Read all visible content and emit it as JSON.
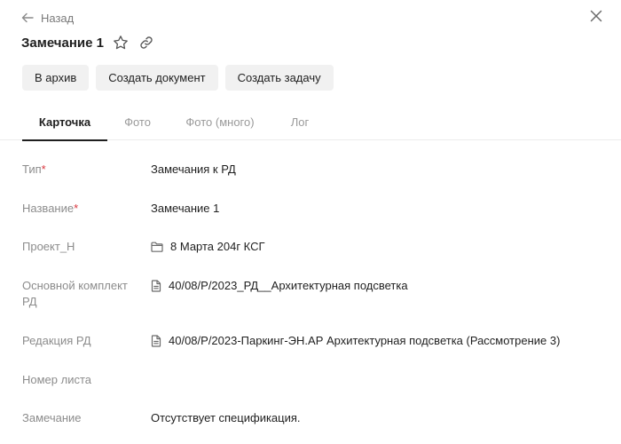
{
  "header": {
    "back_label": "Назад",
    "title": "Замечание 1"
  },
  "actions": [
    {
      "label": "В архив"
    },
    {
      "label": "Создать документ"
    },
    {
      "label": "Создать задачу"
    }
  ],
  "tabs": [
    {
      "label": "Карточка",
      "active": true
    },
    {
      "label": "Фото",
      "active": false
    },
    {
      "label": "Фото (много)",
      "active": false
    },
    {
      "label": "Лог",
      "active": false
    }
  ],
  "fields": [
    {
      "label": "Тип",
      "required": true,
      "required_mark": "*",
      "value": "Замечания к РД",
      "icon": ""
    },
    {
      "label": "Название",
      "required": true,
      "required_mark": "*",
      "value": "Замечание 1",
      "icon": ""
    },
    {
      "label": "Проект_Н",
      "required": false,
      "value": "8 Марта 204г КСГ",
      "icon": "folder-icon"
    },
    {
      "label": "Основной комплект РД",
      "required": false,
      "value": "40/08/Р/2023_РД__Архитектурная подсветка",
      "icon": "document-icon"
    },
    {
      "label": "Редакция РД",
      "required": false,
      "value": "40/08/Р/2023-Паркинг-ЭН.АР Архитектурная подсветка (Рассмотрение 3)",
      "icon": "document-icon"
    },
    {
      "label": "Номер листа",
      "required": false,
      "value": "",
      "icon": ""
    },
    {
      "label": "Замечание",
      "required": false,
      "value": "Отсутствует спецификация.",
      "icon": ""
    }
  ],
  "colors": {
    "required": "#d9363e",
    "muted": "#8c8c8c",
    "button_bg": "#f1f1f1"
  }
}
